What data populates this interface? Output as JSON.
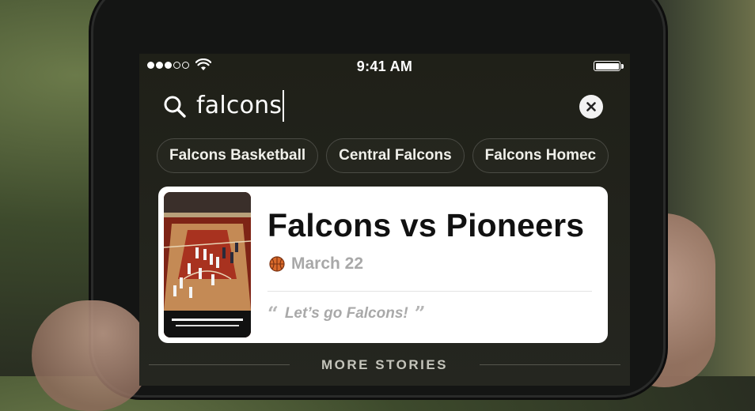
{
  "status_bar": {
    "time": "9:41 AM",
    "signal_bars_filled": 3,
    "signal_bars_total": 5,
    "battery_level": 1.0
  },
  "search": {
    "query": "falcons",
    "search_icon": "search-icon",
    "clear_icon": "close-icon"
  },
  "suggestions": [
    {
      "label": "Falcons Basketball"
    },
    {
      "label": "Central Falcons"
    },
    {
      "label": "Falcons Homec"
    }
  ],
  "story_card": {
    "title": "Falcons vs Pioneers",
    "sport_icon": "basketball-icon",
    "date": "March 22",
    "quote": "Let’s go Falcons!",
    "quote_open": "“",
    "quote_close": "”"
  },
  "more_stories": {
    "label": "MORE STORIES"
  },
  "colors": {
    "screen_background": "#22231c",
    "card_background": "#ffffff",
    "title_text": "#111111",
    "muted_text": "#a8a8a8",
    "chip_border": "#4a4b44"
  }
}
